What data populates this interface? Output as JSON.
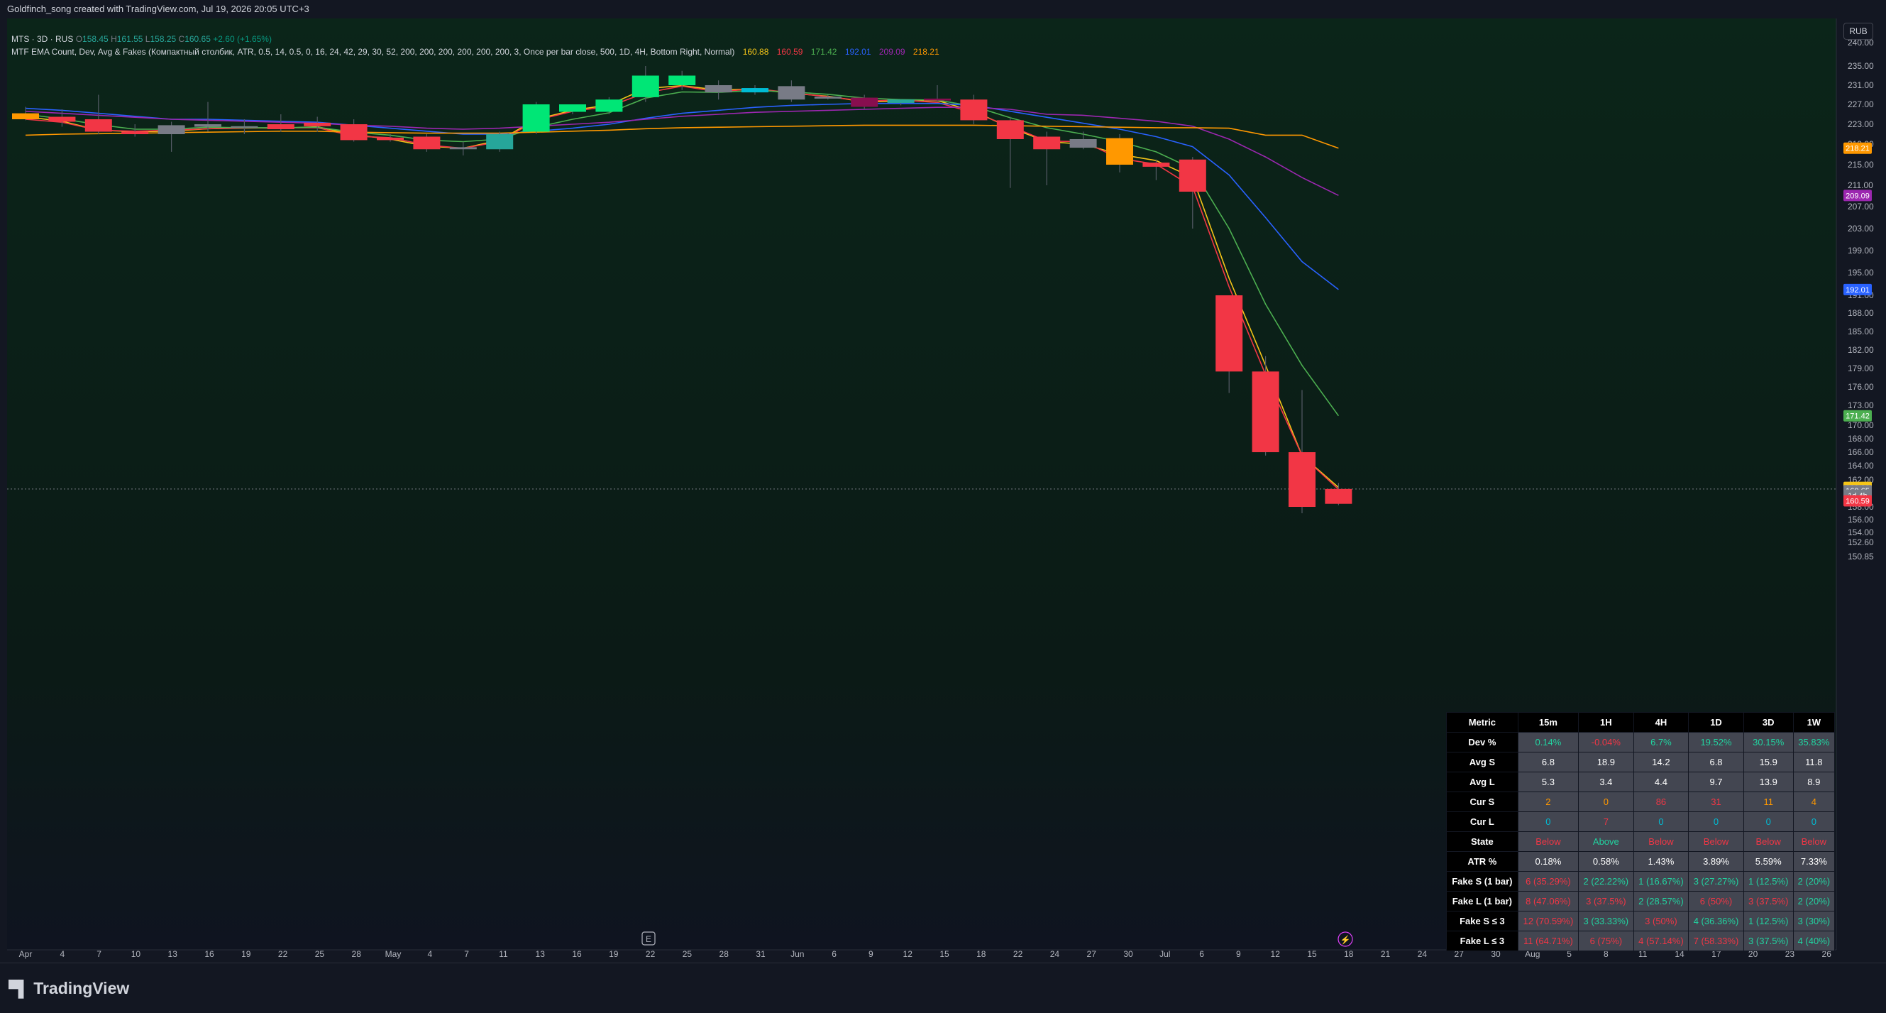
{
  "header": {
    "text": "Goldfinch_song created with TradingView.com, Jul 19, 2026 20:05 UTC+3"
  },
  "legend": {
    "symbol": "MTS · 3D · RUS",
    "ohlc": {
      "O": "158.45",
      "H": "161.55",
      "L": "158.25",
      "C": "160.65",
      "change": "+2.60 (+1.65%)"
    },
    "indicator": "MTF EMA Count, Dev, Avg & Fakes (Компактный столбик, ATR, 0.5, 14, 0.5, 0, 16, 24, 42, 29, 30, 52, 200, 200, 200, 200, 200, 200, 3, Once per bar close, 500, 1D, 4H, Bottom Right, Normal)",
    "values": [
      {
        "v": "160.88",
        "color": "#f5c518"
      },
      {
        "v": "160.59",
        "color": "#f23645"
      },
      {
        "v": "171.42",
        "color": "#4caf50"
      },
      {
        "v": "192.01",
        "color": "#2962ff"
      },
      {
        "v": "209.09",
        "color": "#9c27b0"
      },
      {
        "v": "218.21",
        "color": "#ff9800"
      }
    ]
  },
  "currency": "RUB",
  "yaxis": {
    "ticks": [
      "240.00",
      "235.00",
      "231.00",
      "227.00",
      "223.00",
      "219.00",
      "215.00",
      "211.00",
      "207.00",
      "203.00",
      "199.00",
      "195.00",
      "191.00",
      "188.00",
      "185.00",
      "182.00",
      "179.00",
      "176.00",
      "173.00",
      "170.00",
      "168.00",
      "166.00",
      "164.00",
      "162.00",
      "158.00",
      "156.00",
      "154.00",
      "152.60",
      "150.85"
    ],
    "badges": [
      {
        "label": "218.21",
        "value": 218.21,
        "color": "#ff9800"
      },
      {
        "label": "209.09",
        "value": 209.09,
        "color": "#9c27b0"
      },
      {
        "label": "192.01",
        "value": 192.01,
        "color": "#2962ff"
      },
      {
        "label": "171.42",
        "value": 171.42,
        "color": "#4caf50"
      },
      {
        "label": "160.88",
        "value": 160.88,
        "color": "#f5c518"
      },
      {
        "label": "160.65",
        "value": 160.4,
        "color": "#787b86"
      },
      {
        "label": "1d 4h",
        "value": 159.7,
        "color": "#787b86"
      },
      {
        "label": "160.59",
        "value": 158.9,
        "color": "#f23645"
      }
    ]
  },
  "xaxis": {
    "ticks": [
      "Apr",
      "4",
      "7",
      "10",
      "13",
      "16",
      "19",
      "22",
      "25",
      "28",
      "May",
      "4",
      "7",
      "11",
      "13",
      "16",
      "19",
      "22",
      "25",
      "28",
      "31",
      "Jun",
      "6",
      "9",
      "12",
      "15",
      "18",
      "22",
      "24",
      "27",
      "30",
      "Jul",
      "6",
      "9",
      "12",
      "15",
      "18",
      "21",
      "24",
      "27",
      "30",
      "Aug",
      "5",
      "8",
      "11",
      "14",
      "17",
      "20",
      "23",
      "26"
    ]
  },
  "markers": {
    "earnings": "E",
    "flash": "⚡"
  },
  "metrics": {
    "headers": [
      "Metric",
      "15m",
      "1H",
      "4H",
      "1D",
      "3D",
      "1W"
    ],
    "rows": [
      {
        "label": "Dev %",
        "cells": [
          {
            "t": "0.14%",
            "c": "#22d3a0"
          },
          {
            "t": "-0.04%",
            "c": "#f23645"
          },
          {
            "t": "6.7%",
            "c": "#22d3a0"
          },
          {
            "t": "19.52%",
            "c": "#22d3a0"
          },
          {
            "t": "30.15%",
            "c": "#22d3a0"
          },
          {
            "t": "35.83%",
            "c": "#22d3a0"
          }
        ]
      },
      {
        "label": "Avg S",
        "cells": [
          {
            "t": "6.8",
            "c": "#ffffff"
          },
          {
            "t": "18.9",
            "c": "#ffffff"
          },
          {
            "t": "14.2",
            "c": "#ffffff"
          },
          {
            "t": "6.8",
            "c": "#ffffff"
          },
          {
            "t": "15.9",
            "c": "#ffffff"
          },
          {
            "t": "11.8",
            "c": "#ffffff"
          }
        ]
      },
      {
        "label": "Avg L",
        "cells": [
          {
            "t": "5.3",
            "c": "#ffffff"
          },
          {
            "t": "3.4",
            "c": "#ffffff"
          },
          {
            "t": "4.4",
            "c": "#ffffff"
          },
          {
            "t": "9.7",
            "c": "#ffffff"
          },
          {
            "t": "13.9",
            "c": "#ffffff"
          },
          {
            "t": "8.9",
            "c": "#ffffff"
          }
        ]
      },
      {
        "label": "Cur S",
        "cells": [
          {
            "t": "2",
            "c": "#ff9800"
          },
          {
            "t": "0",
            "c": "#ff9800"
          },
          {
            "t": "86",
            "c": "#f23645"
          },
          {
            "t": "31",
            "c": "#f23645"
          },
          {
            "t": "11",
            "c": "#ff9800"
          },
          {
            "t": "4",
            "c": "#ff9800"
          }
        ]
      },
      {
        "label": "Cur L",
        "cells": [
          {
            "t": "0",
            "c": "#00bcd4"
          },
          {
            "t": "7",
            "c": "#f23645"
          },
          {
            "t": "0",
            "c": "#00bcd4"
          },
          {
            "t": "0",
            "c": "#00bcd4"
          },
          {
            "t": "0",
            "c": "#00bcd4"
          },
          {
            "t": "0",
            "c": "#00bcd4"
          }
        ]
      },
      {
        "label": "State",
        "cells": [
          {
            "t": "Below",
            "c": "#f23645"
          },
          {
            "t": "Above",
            "c": "#22d3a0"
          },
          {
            "t": "Below",
            "c": "#f23645"
          },
          {
            "t": "Below",
            "c": "#f23645"
          },
          {
            "t": "Below",
            "c": "#f23645"
          },
          {
            "t": "Below",
            "c": "#f23645"
          }
        ]
      },
      {
        "label": "ATR %",
        "cells": [
          {
            "t": "0.18%",
            "c": "#ffffff"
          },
          {
            "t": "0.58%",
            "c": "#ffffff"
          },
          {
            "t": "1.43%",
            "c": "#ffffff"
          },
          {
            "t": "3.89%",
            "c": "#ffffff"
          },
          {
            "t": "5.59%",
            "c": "#ffffff"
          },
          {
            "t": "7.33%",
            "c": "#ffffff"
          }
        ]
      },
      {
        "label": "Fake S (1 bar)",
        "cells": [
          {
            "t": "6 (35.29%)",
            "c": "#f23645"
          },
          {
            "t": "2 (22.22%)",
            "c": "#22d3a0"
          },
          {
            "t": "1 (16.67%)",
            "c": "#22d3a0"
          },
          {
            "t": "3 (27.27%)",
            "c": "#22d3a0"
          },
          {
            "t": "1 (12.5%)",
            "c": "#22d3a0"
          },
          {
            "t": "2 (20%)",
            "c": "#22d3a0"
          }
        ]
      },
      {
        "label": "Fake L (1 bar)",
        "cells": [
          {
            "t": "8 (47.06%)",
            "c": "#f23645"
          },
          {
            "t": "3 (37.5%)",
            "c": "#f23645"
          },
          {
            "t": "2 (28.57%)",
            "c": "#22d3a0"
          },
          {
            "t": "6 (50%)",
            "c": "#f23645"
          },
          {
            "t": "3 (37.5%)",
            "c": "#f23645"
          },
          {
            "t": "2 (20%)",
            "c": "#22d3a0"
          }
        ]
      },
      {
        "label": "Fake S ≤ 3",
        "cells": [
          {
            "t": "12 (70.59%)",
            "c": "#f23645"
          },
          {
            "t": "3 (33.33%)",
            "c": "#22d3a0"
          },
          {
            "t": "3 (50%)",
            "c": "#f23645"
          },
          {
            "t": "4 (36.36%)",
            "c": "#22d3a0"
          },
          {
            "t": "1 (12.5%)",
            "c": "#22d3a0"
          },
          {
            "t": "3 (30%)",
            "c": "#22d3a0"
          }
        ]
      },
      {
        "label": "Fake L ≤ 3",
        "cells": [
          {
            "t": "11 (64.71%)",
            "c": "#f23645"
          },
          {
            "t": "6 (75%)",
            "c": "#f23645"
          },
          {
            "t": "4 (57.14%)",
            "c": "#f23645"
          },
          {
            "t": "7 (58.33%)",
            "c": "#f23645"
          },
          {
            "t": "3 (37.5%)",
            "c": "#22d3a0"
          },
          {
            "t": "4 (40%)",
            "c": "#22d3a0"
          }
        ]
      }
    ]
  },
  "branding": "TradingView",
  "candles": [
    {
      "o": 225.2,
      "h": 226.5,
      "l": 223.8,
      "c": 224.0,
      "col": "#ff9800"
    },
    {
      "o": 224.5,
      "h": 226.0,
      "l": 222.5,
      "c": 223.5,
      "col": "#f23645"
    },
    {
      "o": 224.0,
      "h": 229.0,
      "l": 221.0,
      "c": 221.5,
      "col": "#f23645"
    },
    {
      "o": 221.5,
      "h": 223.0,
      "l": 220.5,
      "c": 221.0,
      "col": "#f23645"
    },
    {
      "o": 221.0,
      "h": 223.5,
      "l": 217.5,
      "c": 222.8,
      "col": "#787b86"
    },
    {
      "o": 222.5,
      "h": 227.5,
      "l": 221.5,
      "c": 223.0,
      "col": "#787b86"
    },
    {
      "o": 222.5,
      "h": 224.0,
      "l": 221.0,
      "c": 222.6,
      "col": "#787b86"
    },
    {
      "o": 223.0,
      "h": 225.0,
      "l": 221.5,
      "c": 222.0,
      "col": "#f23645"
    },
    {
      "o": 223.3,
      "h": 224.5,
      "l": 221.5,
      "c": 222.6,
      "col": "#f23645"
    },
    {
      "o": 223.0,
      "h": 224.0,
      "l": 219.5,
      "c": 219.8,
      "col": "#f23645"
    },
    {
      "o": 220.3,
      "h": 221.0,
      "l": 219.5,
      "c": 219.8,
      "col": "#f23645"
    },
    {
      "o": 220.5,
      "h": 221.0,
      "l": 217.5,
      "c": 218.0,
      "col": "#f23645"
    },
    {
      "o": 218.0,
      "h": 219.5,
      "l": 216.8,
      "c": 218.4,
      "col": "#787b86"
    },
    {
      "o": 218.0,
      "h": 221.5,
      "l": 217.5,
      "c": 221.0,
      "col": "#26a69a"
    },
    {
      "o": 221.5,
      "h": 227.5,
      "l": 221.0,
      "c": 227.0,
      "col": "#00e676"
    },
    {
      "o": 225.5,
      "h": 227.0,
      "l": 225.0,
      "c": 227.0,
      "col": "#00e676"
    },
    {
      "o": 225.5,
      "h": 228.5,
      "l": 225.0,
      "c": 228.0,
      "col": "#00e676"
    },
    {
      "o": 228.5,
      "h": 235.0,
      "l": 227.5,
      "c": 233.0,
      "col": "#00e676"
    },
    {
      "o": 231.0,
      "h": 234.0,
      "l": 230.0,
      "c": 233.0,
      "col": "#00e676"
    },
    {
      "o": 231.0,
      "h": 232.0,
      "l": 228.0,
      "c": 229.5,
      "col": "#787b86"
    },
    {
      "o": 229.5,
      "h": 231.0,
      "l": 229.0,
      "c": 230.4,
      "col": "#00bcd4"
    },
    {
      "o": 230.8,
      "h": 232.0,
      "l": 227.5,
      "c": 228.0,
      "col": "#787b86"
    },
    {
      "o": 228.6,
      "h": 229.0,
      "l": 228.0,
      "c": 228.2,
      "col": "#787b86"
    },
    {
      "o": 228.4,
      "h": 229.0,
      "l": 226.0,
      "c": 226.5,
      "col": "#880e4f"
    },
    {
      "o": 227.3,
      "h": 228.0,
      "l": 226.8,
      "c": 228.0,
      "col": "#26a69a"
    },
    {
      "o": 228.2,
      "h": 231.0,
      "l": 227.5,
      "c": 227.8,
      "col": "#880e4f"
    },
    {
      "o": 228.0,
      "h": 229.0,
      "l": 223.0,
      "c": 223.8,
      "col": "#f23645"
    },
    {
      "o": 223.8,
      "h": 224.5,
      "l": 210.5,
      "c": 220.0,
      "col": "#f23645"
    },
    {
      "o": 220.5,
      "h": 221.5,
      "l": 211.0,
      "c": 218.0,
      "col": "#f23645"
    },
    {
      "o": 220.0,
      "h": 221.5,
      "l": 218.0,
      "c": 218.3,
      "col": "#787b86"
    },
    {
      "o": 215.0,
      "h": 221.0,
      "l": 213.5,
      "c": 220.2,
      "col": "#ff9800"
    },
    {
      "o": 215.4,
      "h": 216.0,
      "l": 212.0,
      "c": 214.6,
      "col": "#f23645"
    },
    {
      "o": 216.0,
      "h": 216.5,
      "l": 203.0,
      "c": 209.8,
      "col": "#f23645"
    },
    {
      "o": 191.0,
      "h": 191.0,
      "l": 175.0,
      "c": 178.5,
      "col": "#f23645"
    },
    {
      "o": 178.5,
      "h": 181.0,
      "l": 165.5,
      "c": 166.0,
      "col": "#f23645"
    },
    {
      "o": 166.0,
      "h": 175.5,
      "l": 157.0,
      "c": 158.0,
      "col": "#f23645"
    },
    {
      "o": 160.65,
      "h": 161.55,
      "l": 158.25,
      "c": 158.45,
      "col": "#f23645"
    }
  ],
  "ema_lines": [
    {
      "color": "#f5c518",
      "values": [
        224.5,
        223.6,
        221.8,
        221.5,
        221.6,
        222.1,
        222.3,
        222.2,
        222.5,
        220.9,
        220.0,
        218.6,
        218.2,
        219.8,
        224.0,
        225.8,
        226.9,
        230.3,
        230.9,
        230.0,
        230.2,
        229.3,
        228.7,
        227.5,
        227.7,
        227.8,
        225.6,
        222.3,
        219.5,
        219.0,
        217.0,
        215.8,
        212.5,
        194.0,
        179.5,
        165.5,
        160.88
      ]
    },
    {
      "color": "#f23645",
      "values": [
        224.0,
        223.4,
        221.8,
        221.6,
        221.8,
        222.1,
        222.2,
        222.3,
        222.3,
        220.6,
        220.3,
        218.8,
        218.2,
        219.5,
        223.8,
        225.6,
        226.6,
        229.4,
        230.8,
        229.6,
        230.3,
        229.4,
        228.6,
        227.7,
        227.9,
        227.4,
        225.3,
        222.6,
        219.6,
        219.5,
        216.2,
        215.1,
        210.7,
        192.5,
        178.0,
        165.5,
        160.59
      ]
    },
    {
      "color": "#4caf50",
      "values": [
        225.0,
        224.1,
        222.9,
        222.0,
        222.0,
        222.4,
        222.3,
        222.3,
        222.4,
        221.4,
        220.8,
        219.8,
        219.5,
        220.0,
        222.4,
        224.0,
        225.3,
        228.3,
        229.6,
        229.5,
        229.9,
        229.6,
        229.1,
        228.3,
        228.0,
        227.9,
        226.6,
        224.3,
        222.3,
        221.0,
        219.5,
        217.5,
        214.2,
        203.0,
        189.5,
        179.5,
        171.42
      ]
    },
    {
      "color": "#2962ff",
      "values": [
        226.2,
        225.8,
        225.2,
        224.6,
        224.0,
        224.0,
        223.8,
        223.6,
        223.4,
        222.8,
        222.2,
        221.6,
        221.0,
        221.0,
        221.6,
        222.2,
        223.0,
        224.2,
        225.2,
        225.8,
        226.4,
        226.8,
        227.0,
        227.2,
        227.2,
        227.2,
        226.8,
        225.6,
        224.4,
        223.2,
        222.0,
        220.5,
        218.5,
        213.0,
        205.0,
        197.0,
        192.01
      ]
    },
    {
      "color": "#9c27b0",
      "values": [
        225.6,
        225.2,
        224.8,
        224.4,
        224.0,
        223.8,
        223.6,
        223.4,
        223.2,
        222.8,
        222.6,
        222.2,
        222.0,
        222.2,
        222.6,
        223.0,
        223.4,
        224.0,
        224.6,
        225.0,
        225.4,
        225.6,
        225.8,
        226.0,
        226.2,
        226.4,
        226.4,
        226.0,
        225.0,
        224.8,
        224.2,
        223.6,
        222.6,
        220.0,
        216.5,
        212.5,
        209.09
      ]
    },
    {
      "color": "#ff9800",
      "values": [
        220.8,
        221.0,
        221.1,
        221.2,
        221.3,
        221.4,
        221.5,
        221.6,
        221.6,
        221.4,
        221.3,
        221.2,
        221.2,
        221.2,
        221.4,
        221.6,
        221.8,
        222.1,
        222.3,
        222.4,
        222.5,
        222.6,
        222.7,
        222.8,
        222.8,
        222.8,
        222.8,
        222.7,
        222.6,
        222.5,
        222.4,
        222.3,
        222.3,
        222.2,
        220.8,
        220.8,
        218.21
      ]
    }
  ]
}
